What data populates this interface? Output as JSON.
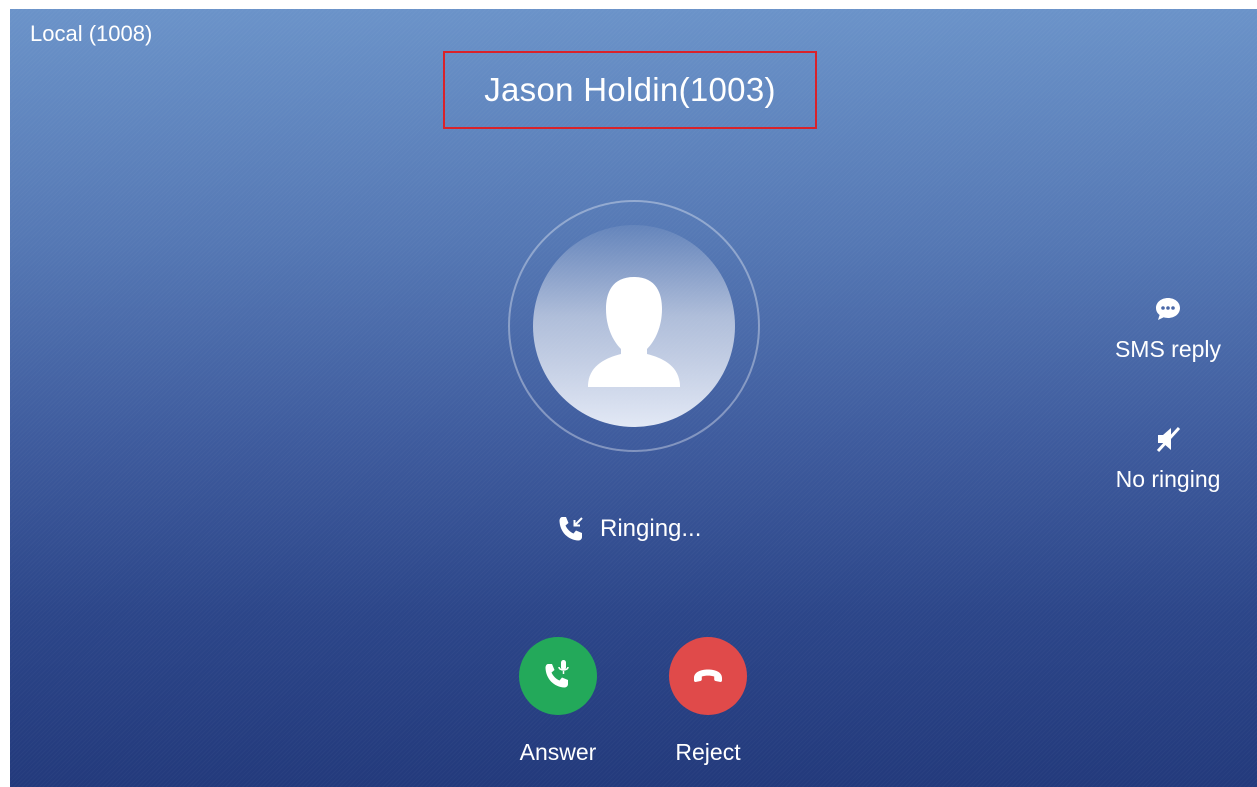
{
  "header": {
    "account_label": "Local (1008)"
  },
  "caller": {
    "name": "Jason Holdin(1003)",
    "avatar_icon": "person-silhouette-icon"
  },
  "call_status": {
    "icon": "incoming-call-icon",
    "text": "Ringing..."
  },
  "side_actions": {
    "sms_reply": {
      "icon": "chat-bubble-icon",
      "label": "SMS reply"
    },
    "no_ringing": {
      "icon": "speaker-mute-icon",
      "label": "No ringing"
    }
  },
  "call_actions": {
    "answer": {
      "icon": "phone-mic-icon",
      "label": "Answer",
      "color": "#23a95a"
    },
    "reject": {
      "icon": "hang-up-icon",
      "label": "Reject",
      "color": "#e04a4a"
    }
  },
  "colors": {
    "highlight_border": "#d9222a",
    "background_top": "#6b93c9",
    "background_bottom": "#233a7c"
  }
}
